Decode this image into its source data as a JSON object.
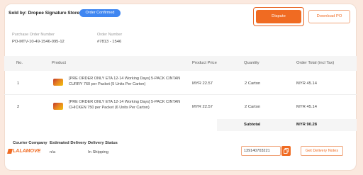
{
  "header": {
    "seller": "Sold by: Dropee Signature Store",
    "status_badge": "Order Confirmed",
    "dispute_label": "Dispute",
    "download_label": "Download PO"
  },
  "order_info": {
    "po_label": "Purchase Order Number",
    "po_value": "PO-MTV-10-49-1546-095-12",
    "order_label": "Order Number",
    "order_value": "#7813 - 1546"
  },
  "table": {
    "columns": [
      "No.",
      "Product",
      "Product Price",
      "Quantity",
      "Order Total (incl Tax)"
    ],
    "rows": [
      {
        "no": "1",
        "product": "[PRE ORDER ONLY ETA 12-14 Working Days] 5-PACK CINTAN CURRY 760 per Packet (5 Units Per Carton)",
        "price": "MYR 22.57",
        "quantity": "2 Carton",
        "total": "MYR 45.14"
      },
      {
        "no": "2",
        "product": "[PRE ORDER ONLY ETA 12-14 Working Days] 5-PACK CINTAN CHICKEN 750 per Packet (6 Units Per Carton)",
        "price": "MYR 22.57",
        "quantity": "2 Carton",
        "total": "MYR 45.14"
      }
    ],
    "subtotal_label": "Subtotal",
    "subtotal_value": "MYR 90.28"
  },
  "delivery": {
    "courier_label": "Courier Company",
    "eta_label": "Estimated Delivery",
    "status_label": "Delivery Status",
    "courier_name": "LALAMOVE",
    "eta_value": "n/a",
    "status_value": "In Shipping",
    "tracking_number": "139140703221",
    "notes_button": "Get Delivery Notes"
  },
  "colors": {
    "accent": "#f06b22",
    "badge": "#3f86f1"
  }
}
